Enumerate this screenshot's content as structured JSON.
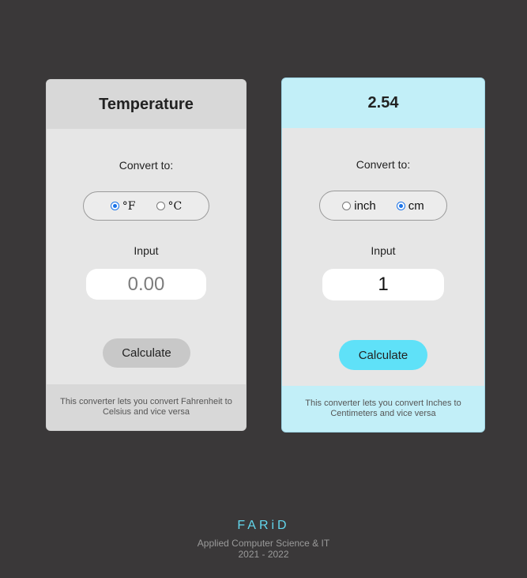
{
  "temperature_card": {
    "title": "Temperature",
    "convert_label": "Convert to:",
    "options": [
      {
        "label": "°F",
        "selected": true
      },
      {
        "label": "°C",
        "selected": false
      }
    ],
    "input_label": "Input",
    "input_placeholder": "0.00",
    "input_value": "",
    "button_label": "Calculate",
    "description": "This converter lets you convert Fahrenheit to Celsius and vice versa"
  },
  "length_card": {
    "title": "2.54",
    "convert_label": "Convert to:",
    "options": [
      {
        "label": "inch",
        "selected": false
      },
      {
        "label": "cm",
        "selected": true
      }
    ],
    "input_label": "Input",
    "input_value": "1",
    "button_label": "Calculate",
    "description": "This converter lets you convert Inches to Centimeters and vice versa"
  },
  "footer": {
    "brand": "FARiD",
    "subtitle": "Applied Computer Science & IT",
    "years": "2021 - 2022"
  },
  "colors": {
    "background": "#3a3839",
    "accent_cyan": "#5fe1f8",
    "light_cyan": "#c2eff8",
    "radio_checked": "#1a73e8",
    "brand_text": "#62d6ec"
  }
}
